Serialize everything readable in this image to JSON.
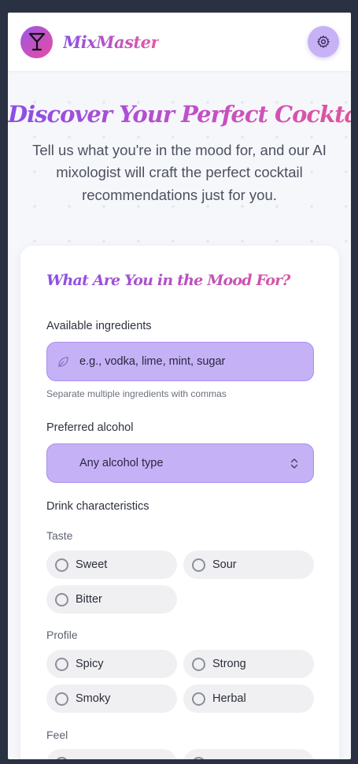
{
  "app": {
    "name": "MixMaster"
  },
  "hero": {
    "title": "Discover Your Perfect Cocktail",
    "description": "Tell us what you're in the mood for, and our AI mixologist will craft the perfect cocktail recommendations just for you."
  },
  "form": {
    "heading": "What Are You in the Mood For?",
    "ingredients": {
      "label": "Available ingredients",
      "placeholder": "e.g., vodka, lime, mint, sugar",
      "hint": "Separate multiple ingredients with commas"
    },
    "alcohol": {
      "label": "Preferred alcohol",
      "selected": "Any alcohol type"
    },
    "characteristics": {
      "label": "Drink characteristics",
      "groups": [
        {
          "name": "Taste",
          "options": [
            "Sweet",
            "Sour",
            "Bitter"
          ]
        },
        {
          "name": "Profile",
          "options": [
            "Spicy",
            "Strong",
            "Smoky",
            "Herbal"
          ]
        },
        {
          "name": "Feel",
          "options": []
        }
      ]
    }
  },
  "colors": {
    "accent_purple": "#8a4fe5",
    "accent_pink": "#e0559d",
    "field_bg": "#c5b2f6"
  },
  "icons": {
    "logo": "cocktail-glass-icon",
    "settings": "gear-icon",
    "ingredients_field": "leaf-icon",
    "alcohol_select": "chevron-updown-icon"
  }
}
